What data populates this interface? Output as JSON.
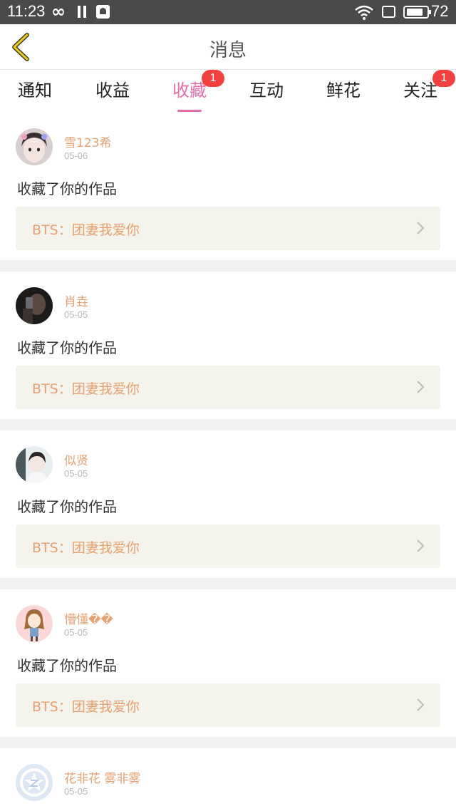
{
  "status_bar": {
    "time": "11:23",
    "infinity": "∞",
    "battery_level": "72"
  },
  "header": {
    "title": "消息",
    "back_icon": "chevron-left-icon"
  },
  "tabs": [
    {
      "label": "通知",
      "badge": null,
      "active": false
    },
    {
      "label": "收益",
      "badge": null,
      "active": false
    },
    {
      "label": "收藏",
      "badge": "1",
      "active": true
    },
    {
      "label": "互动",
      "badge": null,
      "active": false
    },
    {
      "label": "鲜花",
      "badge": null,
      "active": false
    },
    {
      "label": "关注",
      "badge": "1",
      "active": false
    }
  ],
  "colors": {
    "accent": "#e36fa8",
    "name": "#e8a071",
    "badge": "#f2413f",
    "card_bg": "#f4f4ec"
  },
  "items": [
    {
      "username": "雪123希",
      "date": "05-06",
      "action": "收藏了你的作品",
      "work": "BTS：团妻我爱你"
    },
    {
      "username": "肖垚",
      "date": "05-05",
      "action": "收藏了你的作品",
      "work": "BTS：团妻我爱你"
    },
    {
      "username": "似贤",
      "date": "05-05",
      "action": "收藏了你的作品",
      "work": "BTS：团妻我爱你"
    },
    {
      "username": "懵懂��",
      "date": "05-05",
      "action": "收藏了你的作品",
      "work": "BTS：团妻我爱你"
    },
    {
      "username": "花非花 雾非雾",
      "date": "05-05",
      "action": "",
      "work": ""
    }
  ]
}
